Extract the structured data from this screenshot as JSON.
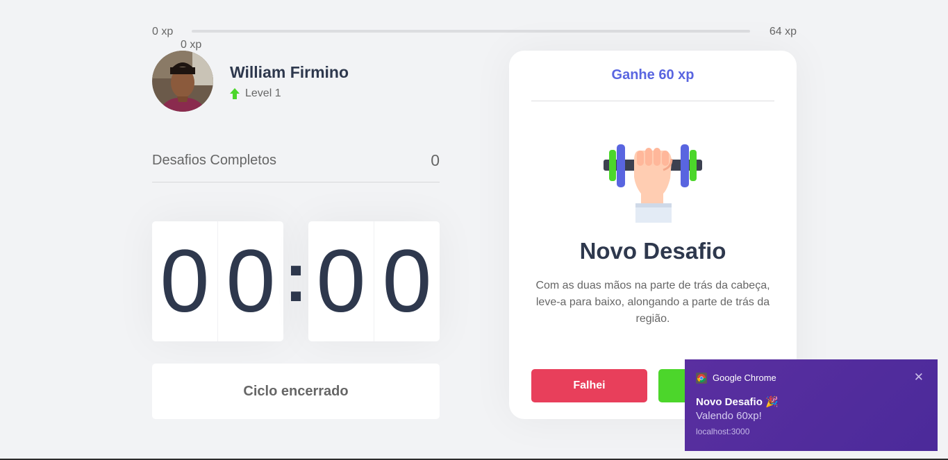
{
  "xp": {
    "min_label": "0 xp",
    "max_label": "64 xp",
    "current_label": "0 xp",
    "progress_fraction": 0
  },
  "profile": {
    "name": "William Firmino",
    "level": "Level 1",
    "level_icon": "level-up-arrow-icon"
  },
  "completed": {
    "label": "Desafios Completos",
    "count": "0"
  },
  "countdown": {
    "minute_left": "0",
    "minute_right": "0",
    "separator": ":",
    "second_left": "0",
    "second_right": "0"
  },
  "cycle_button_label": "Ciclo encerrado",
  "challenge": {
    "header": "Ganhe 60 xp",
    "icon": "dumbbell-icon",
    "title": "Novo Desafio",
    "description": "Com as duas mãos na parte de trás da cabeça, leve-a para baixo, alongando a parte de trás da região.",
    "fail_label": "Falhei",
    "success_label": "",
    "accent_color": "#5965e0",
    "fail_color": "#e83f5b",
    "success_color": "#4cd62b"
  },
  "notification": {
    "app_name": "Google Chrome",
    "app_icon": "chrome-icon",
    "title": "Novo Desafio 🎉",
    "body": "Valendo 60xp!",
    "origin": "localhost:3000",
    "close_glyph": "✕"
  }
}
